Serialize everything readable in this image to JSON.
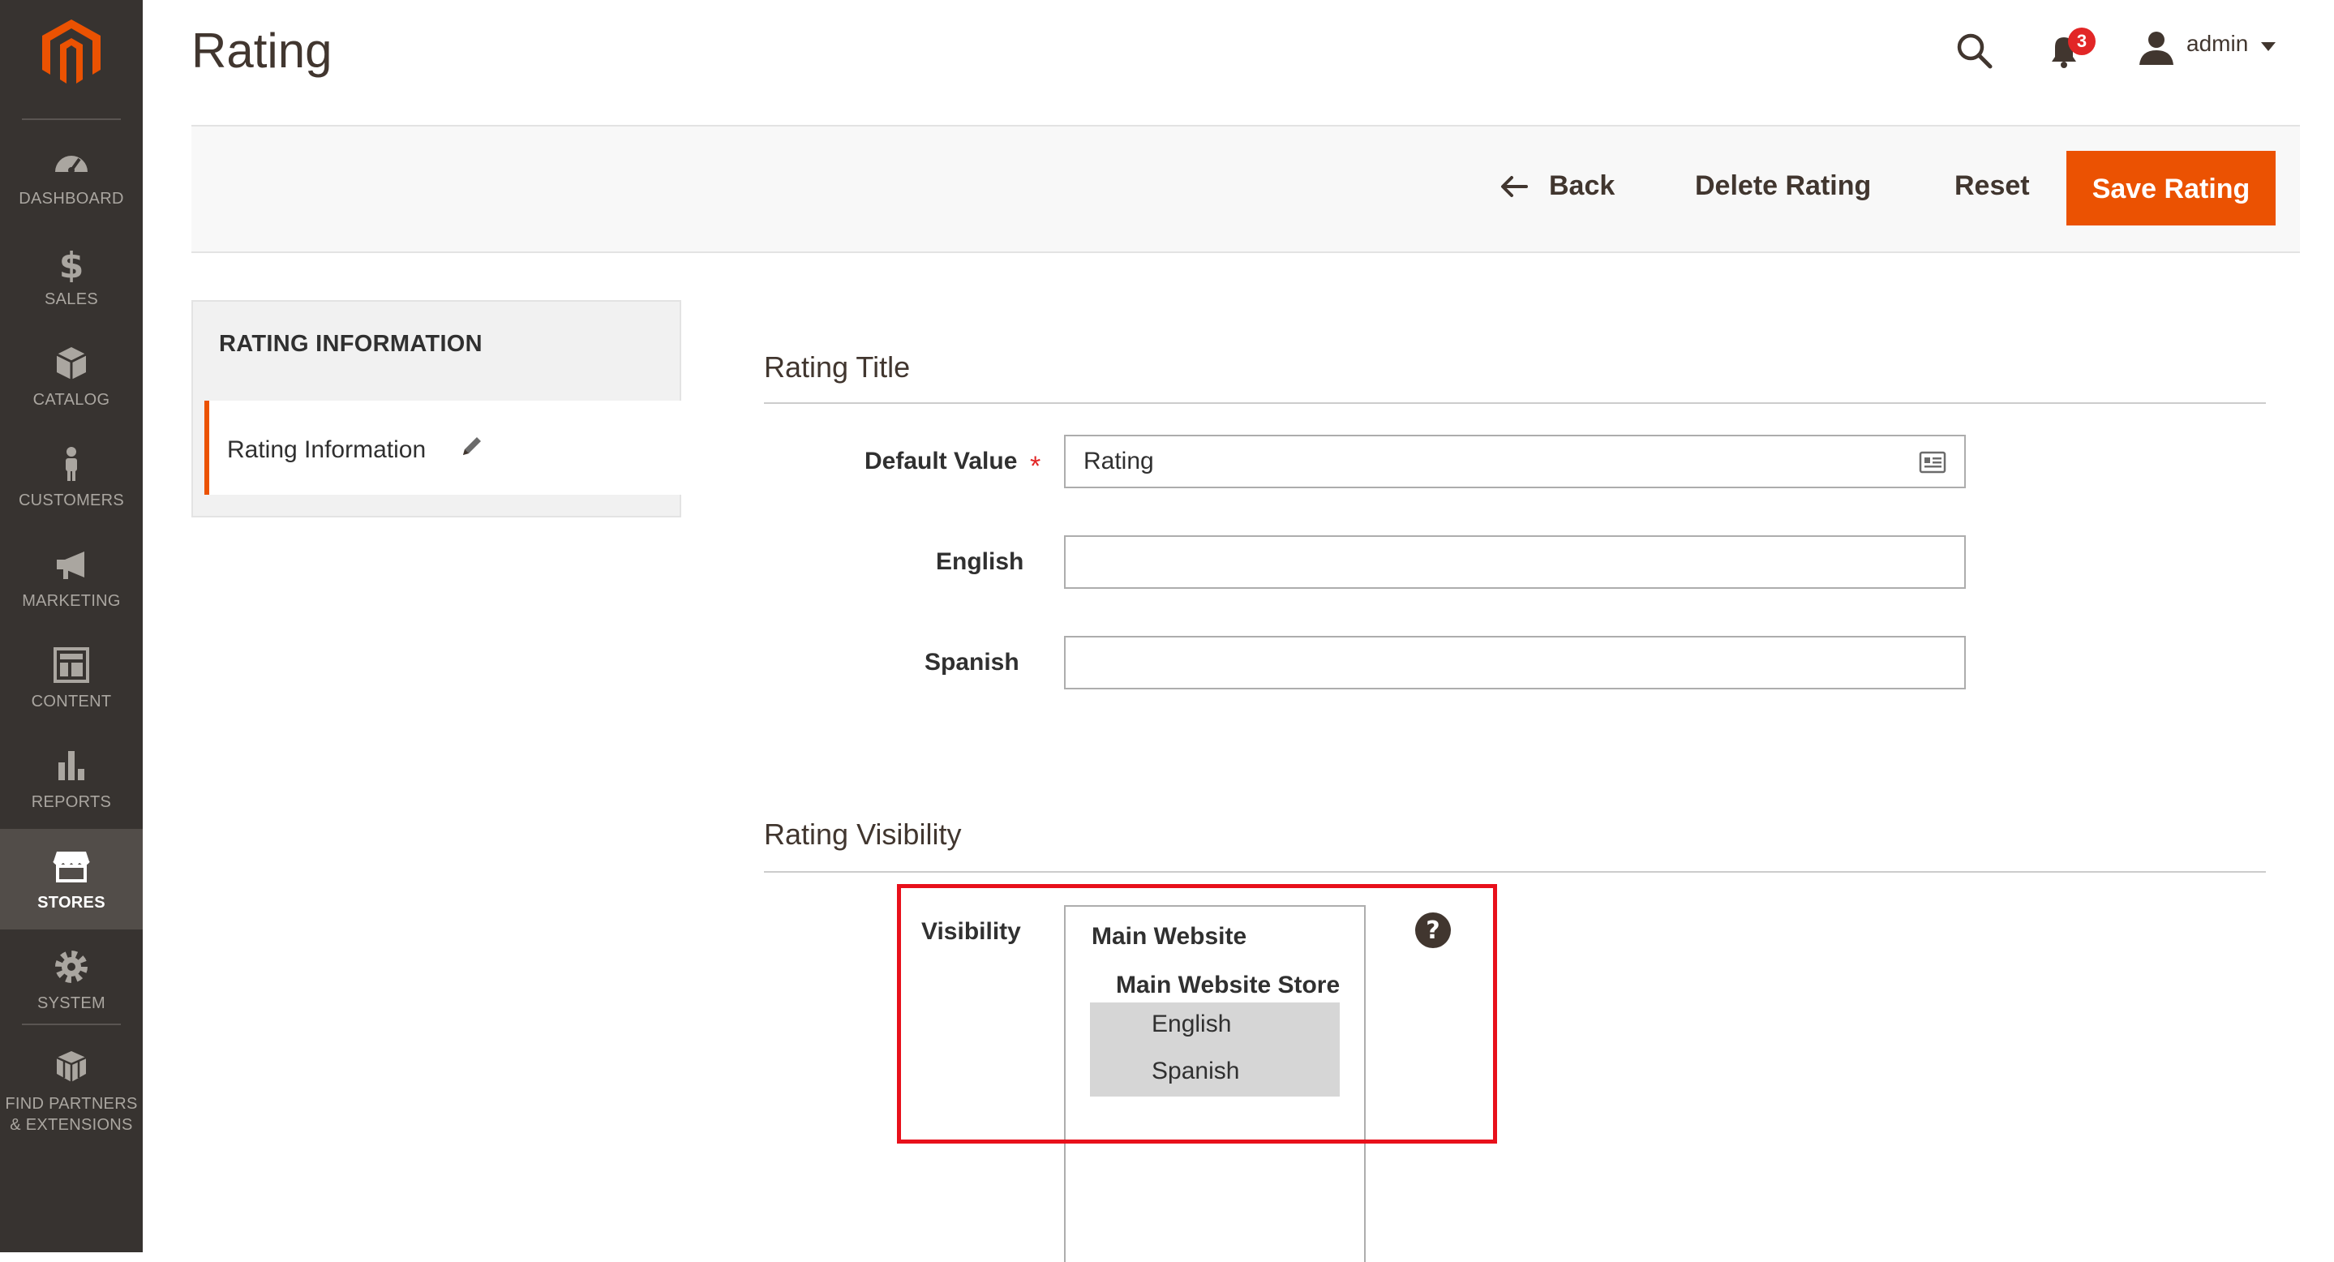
{
  "sidebar": {
    "items": [
      {
        "label": "DASHBOARD",
        "icon": "dashboard-icon"
      },
      {
        "label": "SALES",
        "icon": "dollar-icon"
      },
      {
        "label": "CATALOG",
        "icon": "box-icon"
      },
      {
        "label": "CUSTOMERS",
        "icon": "person-icon"
      },
      {
        "label": "MARKETING",
        "icon": "megaphone-icon"
      },
      {
        "label": "CONTENT",
        "icon": "layout-icon"
      },
      {
        "label": "REPORTS",
        "icon": "bar-chart-icon"
      },
      {
        "label": "STORES",
        "icon": "storefront-icon",
        "active": true
      },
      {
        "label": "SYSTEM",
        "icon": "gear-icon"
      },
      {
        "label_line1": "FIND PARTNERS",
        "label_line2": "& EXTENSIONS",
        "icon": "blocks-icon"
      }
    ]
  },
  "header": {
    "title": "Rating",
    "notifications_count": "3",
    "user": "admin"
  },
  "actions": {
    "back": "Back",
    "delete": "Delete Rating",
    "reset": "Reset",
    "save": "Save Rating"
  },
  "tabs": {
    "title": "RATING INFORMATION",
    "items": [
      {
        "label": "Rating Information"
      }
    ]
  },
  "rating_title": {
    "legend": "Rating Title",
    "fields": [
      {
        "label": "Default Value",
        "value": "Rating",
        "required": true
      },
      {
        "label": "English",
        "value": ""
      },
      {
        "label": "Spanish",
        "value": ""
      }
    ]
  },
  "rating_visibility": {
    "legend": "Rating Visibility",
    "field_label": "Visibility",
    "website": "Main Website",
    "store": "Main Website Store",
    "options": [
      {
        "label": "English",
        "selected": true
      },
      {
        "label": "Spanish",
        "selected": true
      }
    ]
  },
  "colors": {
    "accent": "#eb5202",
    "sidebar_bg": "#373330",
    "highlight": "#e8101b",
    "badge": "#e22626"
  }
}
